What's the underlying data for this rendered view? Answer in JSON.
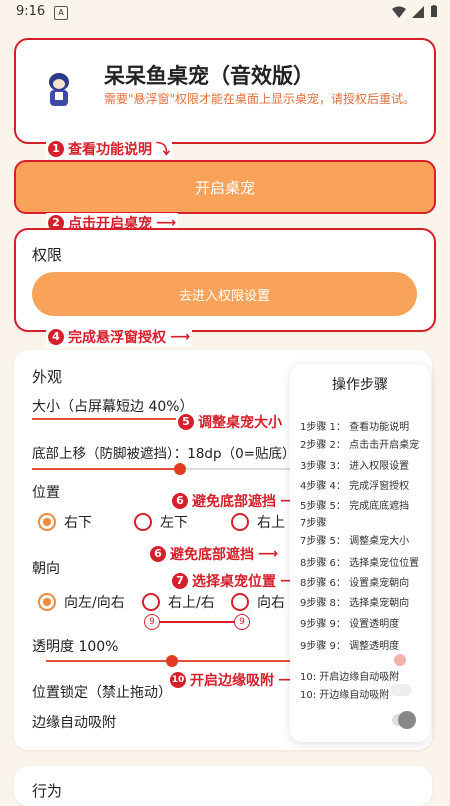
{
  "status": {
    "time": "9:16",
    "a_icon": "A"
  },
  "app": {
    "title": "呆呆鱼桌宠（音效版）",
    "subtitle": "需要\"悬浮窗\"权限才能在桌面上显示桌宠，请授权后重试。"
  },
  "annotations": {
    "a1": "查看功能说明",
    "a2": "点击开启桌宠",
    "a4": "完成悬浮窗授权",
    "a5": "调整桌宠大小",
    "a6a": "避免底部遮挡",
    "a6b": "避免底部遮挡",
    "a7": "选择桌宠位置",
    "a10": "开启边缘吸附",
    "n1": "1",
    "n2": "2",
    "n4": "4",
    "n5": "5",
    "n6": "6",
    "n7": "7",
    "n9": "9",
    "n10": "10"
  },
  "buttons": {
    "start": "开启桌宠",
    "permission_go": "去进入权限设置"
  },
  "permission": {
    "title": "权限"
  },
  "appearance": {
    "title": "外观",
    "size_label": "大小（占屏幕短边 40%）",
    "size_value": 0.4,
    "bottom_label": "底部上移（防脚被遮挡）：18dp（0=贴底）",
    "position_label": "位置",
    "position_options": [
      "右下",
      "左下",
      "右上"
    ],
    "position_selected": "右下",
    "orientation_label": "朝向",
    "orientation_options": [
      "向左/向右",
      "右上/右",
      "向右"
    ],
    "orientation_selected": "向左/向右",
    "opacity_label": "透明度 100%",
    "opacity_value": 1.0,
    "lock_label": "位置锁定（禁止拖动）",
    "edge_label": "边缘自动吸附"
  },
  "behavior": {
    "title": "行为"
  },
  "steps_panel": {
    "title": "操作步骤",
    "items": [
      "1步骤 1：  查看功能说明",
      "2步骤 2：  点击击开启桌宠",
      "3步骤 3：  进入权限设置",
      "4步骤 4：  完成浮窗授权",
      "5步骤 5：  完成底底遮挡",
      "7步骤",
      "7步骤 5：  调整桌宠大小",
      "8步骤 6：  选择桌宠位位置",
      "8步骤 6：  设置桌宠朝向",
      "9步骤 8：  选择桌宠朝向",
      "9步骤 9：  设置透明度",
      "9步骤 9：  调整透明度",
      "10: 开启边缘自动吸附",
      "10:  开边缘自动吸附"
    ]
  },
  "colors": {
    "accent_red": "#d5202b",
    "accent_orange": "#f9a25a",
    "background": "#fbf4ea"
  }
}
